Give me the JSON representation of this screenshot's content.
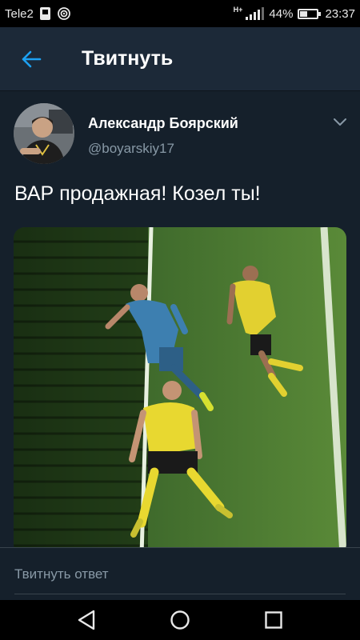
{
  "status_bar": {
    "carrier": "Tele2",
    "network": "H+",
    "battery_percent": "44%",
    "battery_level": 0.44,
    "time": "23:37",
    "icons": [
      "sim-card-icon",
      "hotspot-icon",
      "signal-icon",
      "battery-icon"
    ]
  },
  "header": {
    "title": "Твитнуть",
    "back_icon": "arrow-left-icon"
  },
  "tweet": {
    "author_name": "Александр Боярский",
    "author_handle": "@boyarskiy17",
    "text": "ВАР продажная! Козел ты!",
    "menu_icon": "chevron-down-icon",
    "media": "football-photo"
  },
  "reply": {
    "placeholder": "Твитнуть ответ"
  },
  "colors": {
    "accent": "#1da1f2",
    "background": "#15202b",
    "header_bg": "#1c2938",
    "secondary_text": "#8899a6"
  },
  "nav": {
    "icons": [
      "back-triangle-icon",
      "home-circle-icon",
      "recents-square-icon"
    ]
  }
}
